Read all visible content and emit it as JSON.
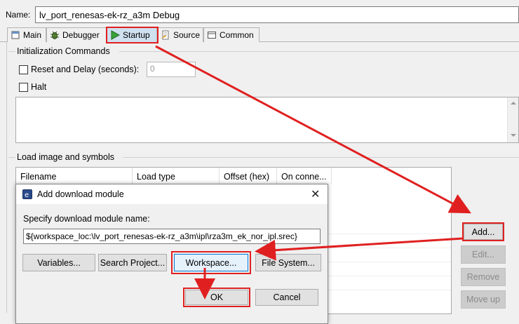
{
  "name_label": "Name:",
  "name_value": "lv_port_renesas-ek-rz_a3m Debug",
  "tabs": [
    {
      "label": "Main",
      "icon": "main-icon"
    },
    {
      "label": "Debugger",
      "icon": "debugger-icon"
    },
    {
      "label": "Startup",
      "icon": "startup-icon"
    },
    {
      "label": "Source",
      "icon": "source-icon"
    },
    {
      "label": "Common",
      "icon": "common-icon"
    }
  ],
  "init": {
    "title": "Initialization Commands",
    "reset_label": "Reset and Delay (seconds):",
    "reset_value": "0",
    "halt_label": "Halt"
  },
  "load": {
    "title": "Load image and symbols",
    "columns": [
      "Filename",
      "Load type",
      "Offset (hex)",
      "On conne..."
    ]
  },
  "side_buttons": {
    "add": "Add...",
    "edit": "Edit...",
    "remove": "Remove",
    "move_up": "Move up"
  },
  "dialog": {
    "title": "Add download module",
    "close": "✕",
    "label": "Specify download module name:",
    "value": "${workspace_loc:\\lv_port_renesas-ek-rz_a3m\\ipl\\rza3m_ek_nor_ipl.srec}",
    "buttons": {
      "variables": "Variables...",
      "search_project": "Search Project...",
      "workspace": "Workspace...",
      "file_system": "File System...",
      "ok": "OK",
      "cancel": "Cancel"
    }
  },
  "colors": {
    "annotation": "#e02020",
    "active_tab": "#cfe0ef",
    "focus": "#0078d7"
  }
}
